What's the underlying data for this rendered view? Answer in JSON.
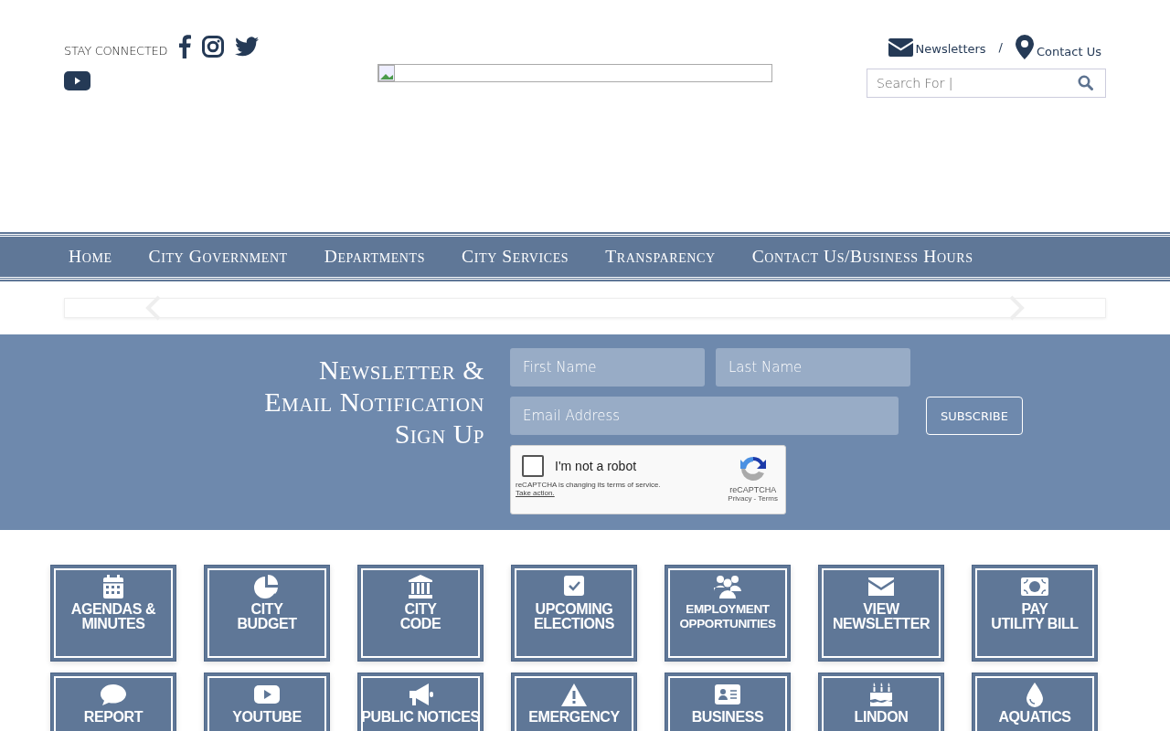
{
  "header": {
    "stay_connected": "STAY CONNECTED",
    "social": [
      {
        "kind": "facebook"
      },
      {
        "kind": "instagram"
      },
      {
        "kind": "twitter"
      },
      {
        "kind": "youtube"
      }
    ],
    "links": [
      {
        "kind": "mail",
        "label": "Newsletters"
      },
      {
        "kind": "pin",
        "label": "Contact Us"
      }
    ],
    "separator": "/",
    "search": {
      "placeholder": "Search For |"
    }
  },
  "nav": [
    {
      "label": "Home"
    },
    {
      "label": "City Government"
    },
    {
      "label": "Departments"
    },
    {
      "label": "City Services"
    },
    {
      "label": "Transparency"
    },
    {
      "label": "Contact Us/Business Hours"
    }
  ],
  "signup": {
    "title_lines": [
      "Newsletter &",
      "Email Notification",
      "Sign Up"
    ],
    "first_name": {
      "placeholder": "First Name"
    },
    "last_name": {
      "placeholder": "Last Name"
    },
    "email": {
      "placeholder": "Email Address"
    },
    "subscribe": "SUBSCRIBE",
    "captcha": {
      "checked": false,
      "label": "I'm not a robot",
      "notice": "reCAPTCHA is changing its terms of service.",
      "action": "Take action.",
      "brand": "reCAPTCHA",
      "privacy": "Privacy",
      "dash": "-",
      "terms": "Terms"
    }
  },
  "tiles": [
    {
      "kind": "calendar",
      "lines": [
        "AGENDAS &",
        "MINUTES"
      ]
    },
    {
      "kind": "pie",
      "lines": [
        "CITY",
        "BUDGET"
      ]
    },
    {
      "kind": "building",
      "lines": [
        "CITY",
        "CODE"
      ]
    },
    {
      "kind": "check",
      "lines": [
        "UPCOMING",
        "ELECTIONS"
      ]
    },
    {
      "kind": "people",
      "lines": [
        "EMPLOYMENT",
        "OPPORTUNITIES"
      ]
    },
    {
      "kind": "mail",
      "lines": [
        "VIEW",
        "NEWSLETTER"
      ]
    },
    {
      "kind": "money",
      "lines": [
        "PAY",
        "UTILITY BILL"
      ]
    },
    {
      "kind": "comment",
      "lines": [
        "REPORT"
      ]
    },
    {
      "kind": "youtube",
      "lines": [
        "YOUTUBE"
      ]
    },
    {
      "kind": "megaphone",
      "lines": [
        "PUBLIC NOTICES"
      ]
    },
    {
      "kind": "warning",
      "lines": [
        "EMERGENCY"
      ]
    },
    {
      "kind": "idcard",
      "lines": [
        "BUSINESS"
      ]
    },
    {
      "kind": "cake",
      "lines": [
        "LINDON"
      ]
    },
    {
      "kind": "drop",
      "lines": [
        "AQUATICS"
      ]
    }
  ]
}
